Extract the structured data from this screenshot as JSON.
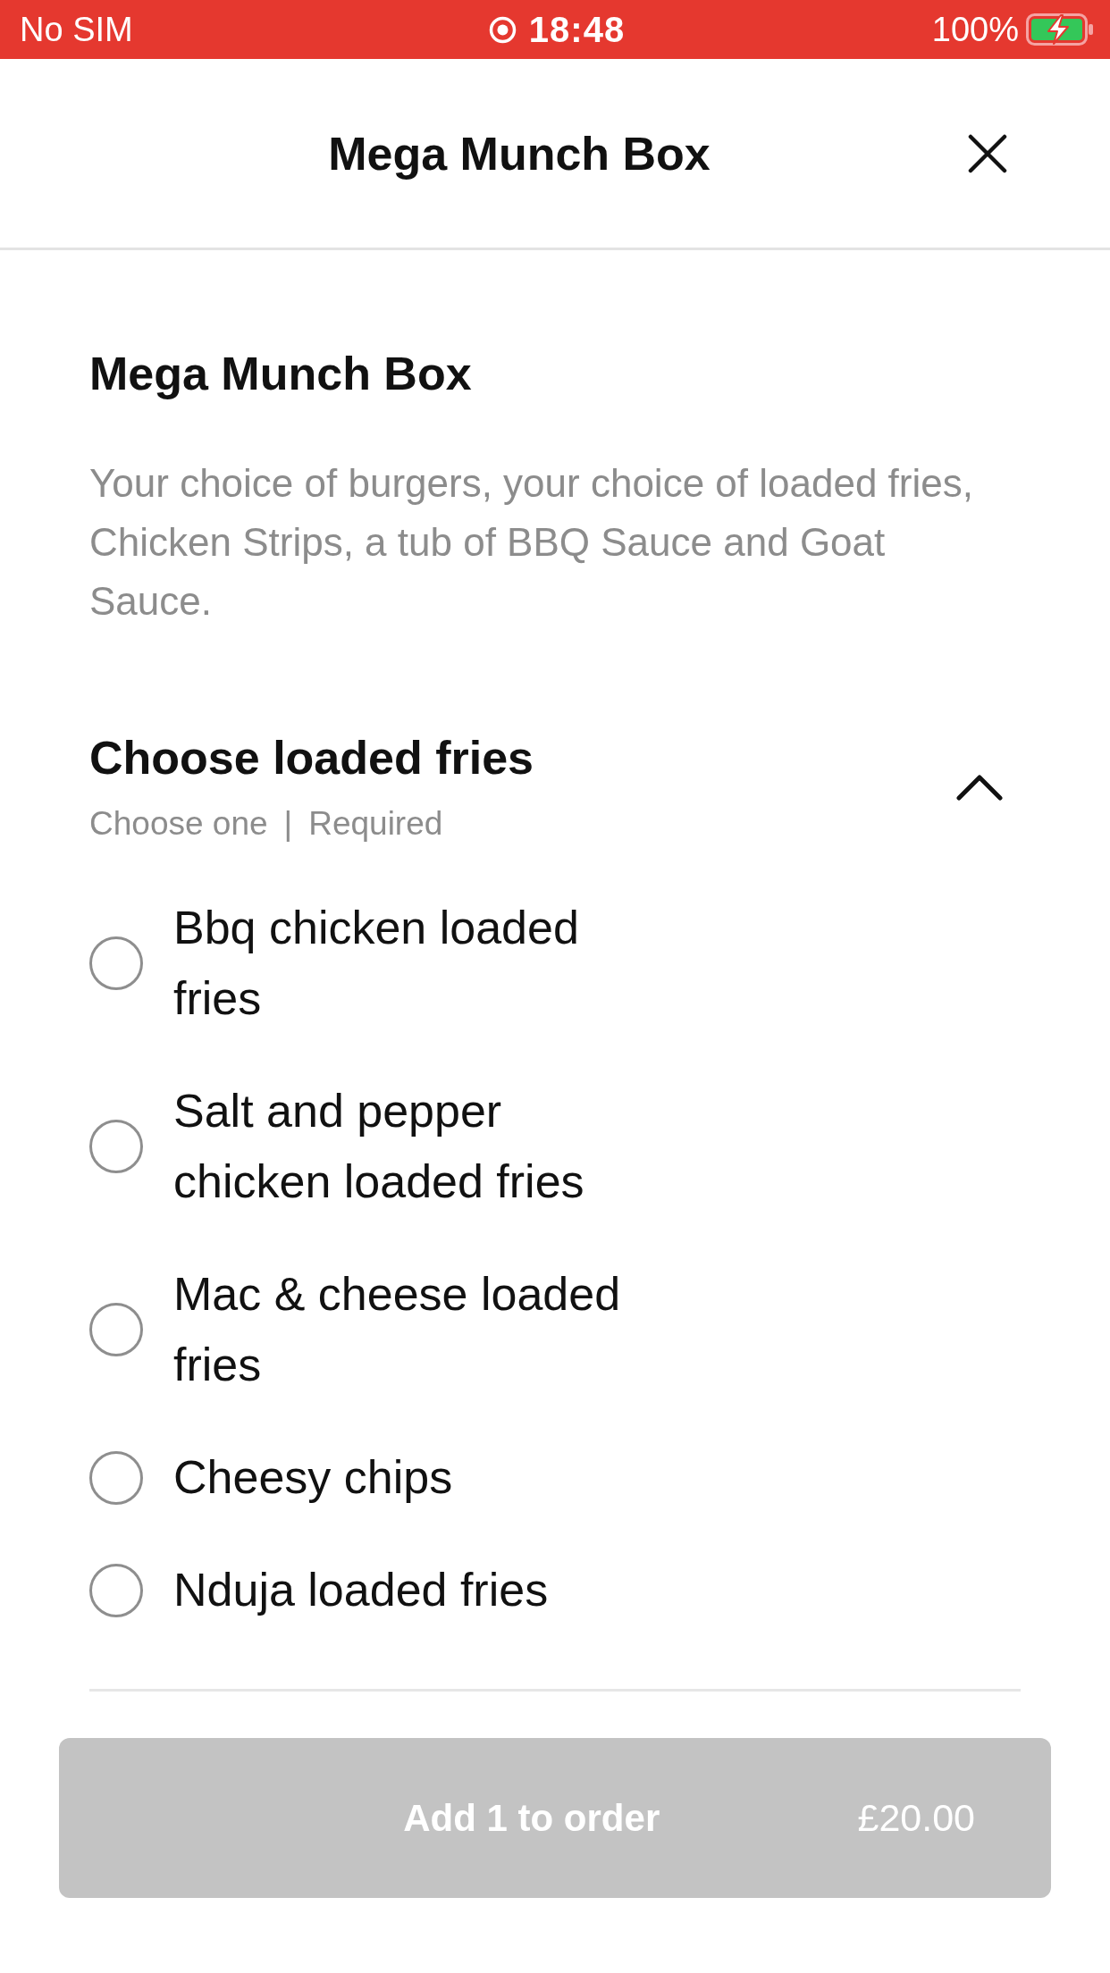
{
  "status_bar": {
    "carrier": "No SIM",
    "time": "18:48",
    "battery": "100%"
  },
  "header": {
    "title": "Mega Munch Box"
  },
  "item": {
    "name": "Mega Munch Box",
    "description": "Your choice of burgers, your choice of loaded fries, Chicken Strips, a tub of BBQ Sauce and Goat Sauce."
  },
  "modifier_group": {
    "title": "Choose loaded fries",
    "hints": [
      "Choose one",
      "Required"
    ],
    "separator": "|",
    "expanded": true,
    "options": [
      {
        "label": "Bbq chicken loaded fries",
        "selected": false
      },
      {
        "label": "Salt and pepper chicken loaded fries",
        "selected": false
      },
      {
        "label": "Mac & cheese loaded fries",
        "selected": false
      },
      {
        "label": "Cheesy chips",
        "selected": false
      },
      {
        "label": "Nduja loaded fries",
        "selected": false
      }
    ]
  },
  "order_button": {
    "label": "Add 1 to order",
    "price": "£20.00",
    "disabled": true
  }
}
